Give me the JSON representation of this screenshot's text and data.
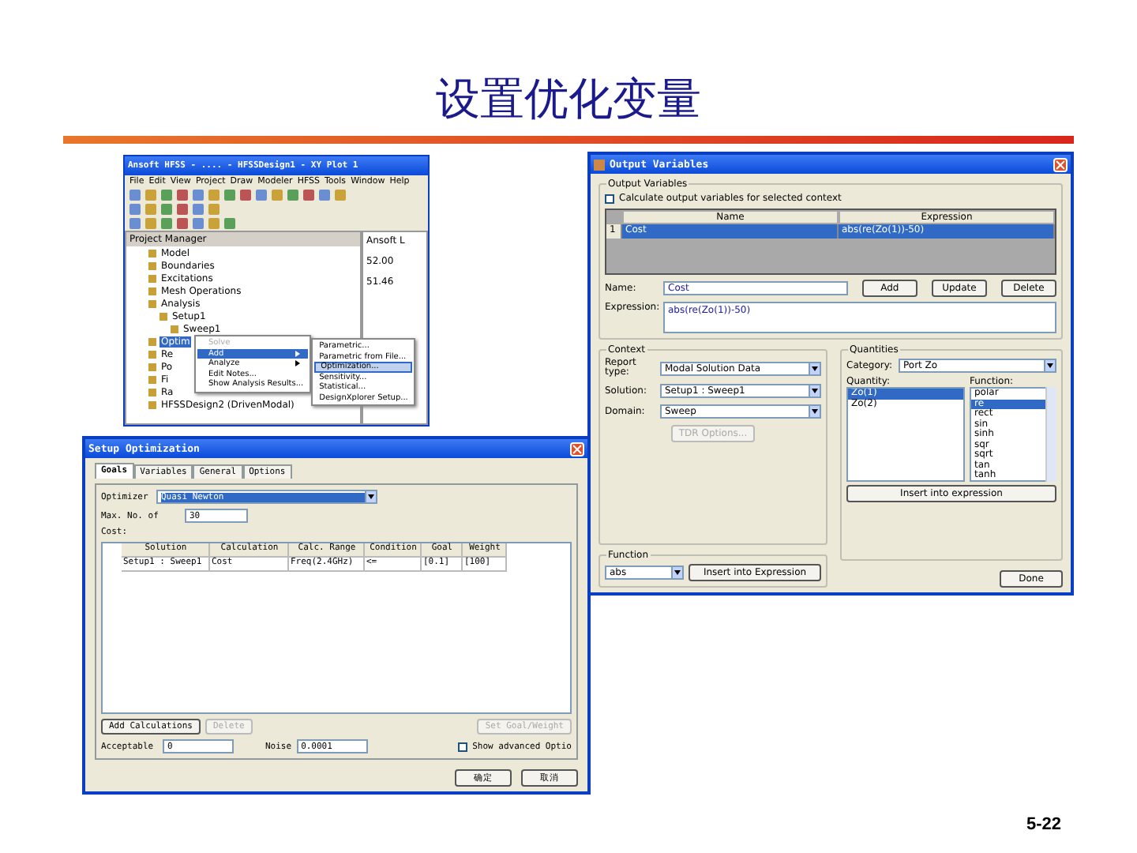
{
  "slide": {
    "title": "设置优化变量",
    "page_number": "5-22"
  },
  "hfss_window": {
    "title": "Ansoft HFSS - .... - HFSSDesign1 - XY Plot 1",
    "menu": [
      "File",
      "Edit",
      "View",
      "Project",
      "Draw",
      "Modeler",
      "HFSS",
      "Tools",
      "Window",
      "Help"
    ],
    "panel_title": "Project Manager",
    "tree": [
      {
        "label": "Model",
        "selected": false
      },
      {
        "label": "Boundaries",
        "selected": false
      },
      {
        "label": "Excitations",
        "selected": false
      },
      {
        "label": "Mesh Operations",
        "selected": false
      },
      {
        "label": "Analysis",
        "selected": false,
        "children": [
          {
            "label": "Setup1",
            "selected": false,
            "children": [
              {
                "label": "Sweep1",
                "selected": false
              }
            ]
          }
        ]
      },
      {
        "label": "Optim",
        "selected": true
      },
      {
        "label": "Re",
        "selected": false
      },
      {
        "label": "Po",
        "selected": false
      },
      {
        "label": "Fi",
        "selected": false
      },
      {
        "label": "Ra",
        "selected": false
      },
      {
        "label": "HFSSDesign2 (DrivenModal)",
        "selected": false
      }
    ],
    "plot_texts": [
      "Ansoft L",
      "52.00",
      "51.46"
    ],
    "context_menu": [
      {
        "label": "Solve",
        "disabled": true,
        "submenu": false,
        "selected": false
      },
      {
        "label": "Add",
        "disabled": false,
        "submenu": true,
        "selected": true
      },
      {
        "label": "Analyze",
        "disabled": false,
        "submenu": true,
        "selected": false
      },
      {
        "label": "Edit Notes...",
        "disabled": false,
        "submenu": false,
        "selected": false
      },
      {
        "label": "Show Analysis Results...",
        "disabled": false,
        "submenu": false,
        "selected": false
      }
    ],
    "submenu": [
      {
        "label": "Parametric...",
        "selected": false
      },
      {
        "label": "Parametric from File...",
        "selected": false
      },
      {
        "label": "Optimization...",
        "selected": true
      },
      {
        "label": "Sensitivity...",
        "selected": false
      },
      {
        "label": "Statistical...",
        "selected": false
      },
      {
        "label": "DesignXplorer Setup...",
        "selected": false
      }
    ]
  },
  "output_variables": {
    "title": "Output Variables",
    "group": "Output Variables",
    "calc_checkbox": {
      "label": "Calculate output variables for selected context",
      "checked": false
    },
    "columns": [
      "Name",
      "Expression"
    ],
    "rows": [
      {
        "number": "1",
        "name": "Cost",
        "expression": "abs(re(Zo(1))-50)",
        "selected": true
      }
    ],
    "name_label": "Name:",
    "name_value": "Cost",
    "buttons": [
      "Add",
      "Update",
      "Delete"
    ],
    "expression_label": "Expression:",
    "expression_value": "abs(re(Zo(1))-50)",
    "context": {
      "title": "Context",
      "fields": [
        {
          "label": "Report type:",
          "value": "Modal Solution Data"
        },
        {
          "label": "Solution:",
          "value": "Setup1 : Sweep1"
        },
        {
          "label": "Domain:",
          "value": "Sweep"
        }
      ],
      "tdr_button": {
        "label": "TDR Options...",
        "disabled": true
      }
    },
    "quantities": {
      "title": "Quantities",
      "category_label": "Category:",
      "category": "Port Zo",
      "quantity_label": "Quantity:",
      "quantity": [
        {
          "label": "Zo(1)",
          "selected": true
        },
        {
          "label": "Zo(2)",
          "selected": false
        }
      ],
      "function_label": "Function:",
      "functions": [
        {
          "label": "polar",
          "selected": false
        },
        {
          "label": "re",
          "selected": true
        },
        {
          "label": "rect",
          "selected": false
        },
        {
          "label": "sin",
          "selected": false
        },
        {
          "label": "sinh",
          "selected": false
        },
        {
          "label": "sqr",
          "selected": false
        },
        {
          "label": "sqrt",
          "selected": false
        },
        {
          "label": "tan",
          "selected": false
        },
        {
          "label": "tanh",
          "selected": false
        }
      ],
      "insert_button": "Insert into expression"
    },
    "function": {
      "title": "Function",
      "value": "abs",
      "insert_button": "Insert into Expression"
    },
    "done_button": "Done"
  },
  "setup_optimization": {
    "title": "Setup Optimization",
    "tabs": [
      {
        "label": "Goals",
        "selected": true
      },
      {
        "label": "Variables",
        "selected": false
      },
      {
        "label": "General",
        "selected": false
      },
      {
        "label": "Options",
        "selected": false
      }
    ],
    "optimizer_label": "Optimizer",
    "optimizer": "Quasi Newton",
    "max_label": "Max. No. of",
    "max_value": "30",
    "cost_label": "Cost:",
    "columns": [
      "Solution",
      "Calculation",
      "Calc. Range",
      "Condition",
      "Goal",
      "Weight"
    ],
    "rows": [
      {
        "cells": [
          "Setup1 : Sweep1",
          "Cost",
          "Freq(2.4GHz)",
          "<=",
          "[0.1]",
          "[100]"
        ]
      }
    ],
    "add_button": {
      "label": "Add Calculations",
      "disabled": false
    },
    "delete_button": {
      "label": "Delete",
      "disabled": true
    },
    "goal_button": {
      "label": "Set Goal/Weight",
      "disabled": true
    },
    "acceptable_label": "Acceptable",
    "acceptable_value": "0",
    "noise_label": "Noise",
    "noise_value": "0.0001",
    "advanced_checkbox": {
      "label": "Show advanced Optio",
      "checked": false
    },
    "ok_button": "确定",
    "cancel_button": "取消"
  }
}
